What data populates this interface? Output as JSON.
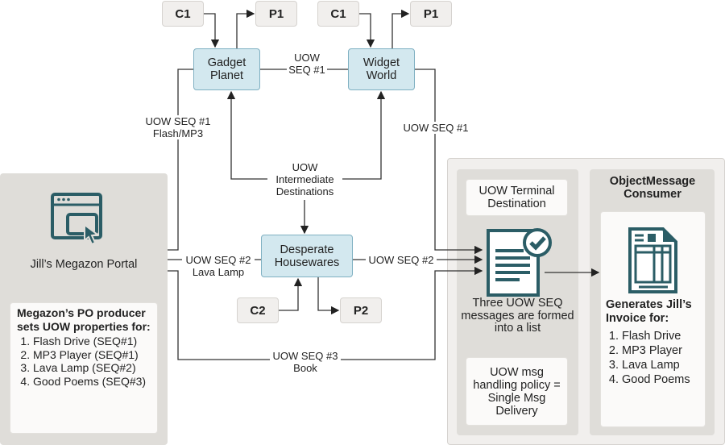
{
  "nodes": {
    "c1_left": "C1",
    "p1_left": "P1",
    "c1_right": "C1",
    "p1_right": "P1",
    "gadget_planet": "Gadget Planet",
    "widget_world": "Widget World",
    "desperate_housewares": "Desperate Housewares",
    "c2": "C2",
    "p2": "P2"
  },
  "edge_labels": {
    "gadget_widget": "UOW SEQ #1",
    "flash_mp3": "UOW SEQ #1 Flash/MP3",
    "widget_out": "UOW SEQ #1",
    "intermediate": "UOW Intermediate Destinations",
    "lava_lamp": "UOW SEQ #2 Lava Lamp",
    "housewares_out": "UOW SEQ #2",
    "book": "UOW SEQ #3 Book"
  },
  "portal": {
    "title": "Jill’s Megazon Portal",
    "producer_heading": "Megazon’s PO producer sets UOW properties for:",
    "items": [
      "Flash Drive (SEQ#1)",
      "MP3 Player (SEQ#1)",
      "Lava Lamp (SEQ#2)",
      "Good Poems (SEQ#3)"
    ]
  },
  "terminal": {
    "title": "UOW Terminal Destination",
    "caption": "Three UOW SEQ messages are formed into a list",
    "policy": "UOW msg handling policy = Single Msg Delivery"
  },
  "consumer": {
    "title": "ObjectMessage Consumer",
    "heading": "Generates Jill’s Invoice for:",
    "items": [
      "Flash Drive",
      "MP3 Player",
      "Lava Lamp",
      "Good Poems"
    ]
  },
  "colors": {
    "icon": "#2b5d66",
    "node_fill": "#d3e8ef",
    "panel": "#dfddd9"
  }
}
